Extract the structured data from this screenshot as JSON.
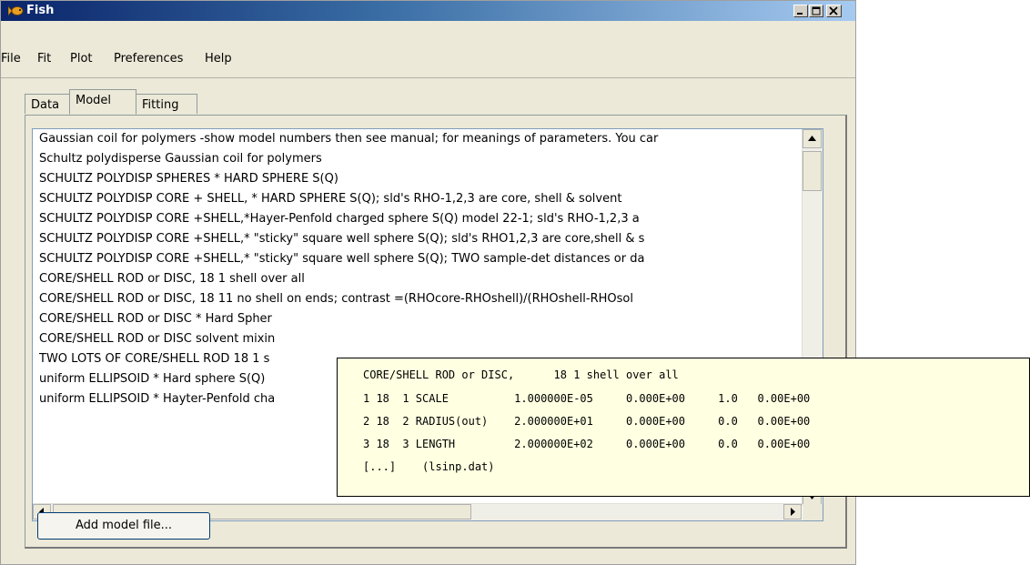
{
  "window": {
    "title": "Fish",
    "icon": "fish-icon",
    "controls": [
      "minimize-icon",
      "maximize-icon",
      "close-icon"
    ]
  },
  "menu": [
    "File",
    "Fit",
    "Plot",
    "Preferences",
    "Help"
  ],
  "tabs": [
    {
      "label": "Data",
      "active": false
    },
    {
      "label": "Model",
      "active": true
    },
    {
      "label": "Fitting",
      "active": false
    }
  ],
  "model_list": [
    "Gaussian coil for polymers -show model numbers then see manual; for meanings of parameters. You car",
    "Schultz polydisperse Gaussian coil for polymers",
    "SCHULTZ POLYDISP SPHERES * HARD SPHERE S(Q)",
    "SCHULTZ POLYDISP CORE + SHELL, * HARD SPHERE S(Q); sld's RHO-1,2,3 are core, shell & solvent",
    "SCHULTZ POLYDISP CORE +SHELL,*Hayer-Penfold charged sphere S(Q) model 22-1; sld's RHO-1,2,3 a",
    "SCHULTZ POLYDISP CORE +SHELL,* \"sticky\" square well sphere S(Q); sld's RHO1,2,3 are core,shell & s",
    "SCHULTZ POLYDISP CORE +SHELL,* \"sticky\" square well sphere S(Q); TWO sample-det distances or da",
    "CORE/SHELL ROD or DISC,     18 1 shell over all",
    "CORE/SHELL ROD or DISC,     18 11 no shell on ends; contrast =(RHOcore-RHOshell)/(RHOshell-RHOsol",
    "CORE/SHELL ROD or DISC * Hard Spher",
    "CORE/SHELL ROD or DISC solvent mixin",
    "TWO LOTS OF CORE/SHELL ROD  18 1 s",
    "uniform ELLIPSOID * Hard sphere S(Q)",
    "uniform ELLIPSOID * Hayter-Penfold cha"
  ],
  "add_button": "Add model file...",
  "tooltip": [
    "CORE/SHELL ROD or DISC,      18 1 shell over all",
    "1 18  1 SCALE          1.000000E-05     0.000E+00     1.0   0.00E+00",
    "2 18  2 RADIUS(out)    2.000000E+01     0.000E+00     0.0   0.00E+00",
    "3 18  3 LENGTH         2.000000E+02     0.000E+00     0.0   0.00E+00",
    "[...]    (lsinp.dat)"
  ],
  "colors": {
    "title_gradient_start": "#0a246a",
    "title_gradient_end": "#a6caf0",
    "window_bg": "#ece9d8",
    "tooltip_bg": "#ffffe1"
  }
}
